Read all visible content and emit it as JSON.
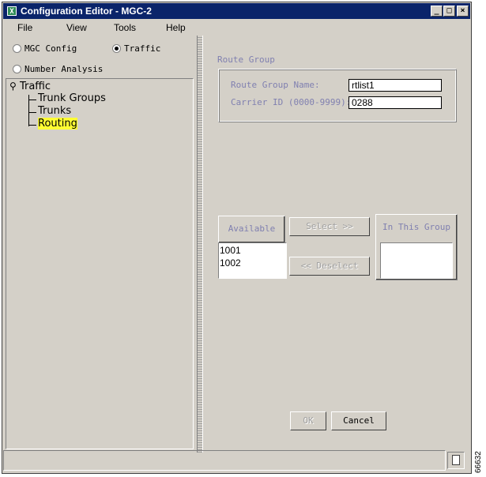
{
  "window": {
    "icon_glyph": "X",
    "title": "Configuration Editor - MGC-2",
    "minimize_glyph": "_",
    "maximize_glyph": "□",
    "close_glyph": "×"
  },
  "menu": {
    "file": "File",
    "view": "View",
    "tools": "Tools",
    "help": "Help"
  },
  "modes": {
    "mgc_config": "MGC Config",
    "traffic": "Traffic",
    "number_analysis": "Number Analysis",
    "selected": "Traffic"
  },
  "tree": {
    "root": "Traffic",
    "items": [
      "Trunk Groups",
      "Trunks",
      "Routing"
    ],
    "selected": "Routing",
    "highlight_color": "#ffff33"
  },
  "route_group": {
    "section_title": "Route Group",
    "name_label": "Route Group Name:",
    "name_value": "rtlist1",
    "carrier_label": "Carrier ID (0000-9999):",
    "carrier_value": "0288"
  },
  "trunk_assignment": {
    "available_label": "Available",
    "available_items": [
      "1001",
      "1002"
    ],
    "select_button": "Select >>",
    "deselect_button": "<< Deselect",
    "in_group_label": "In This Group",
    "in_group_items": []
  },
  "footer": {
    "ok_button": "OK",
    "cancel_button": "Cancel"
  },
  "status": {
    "text": "",
    "icon": "document-icon"
  },
  "side_number": "66632",
  "colors": {
    "title_bar": "#0a246a",
    "disabled_text": "#8080b0"
  }
}
